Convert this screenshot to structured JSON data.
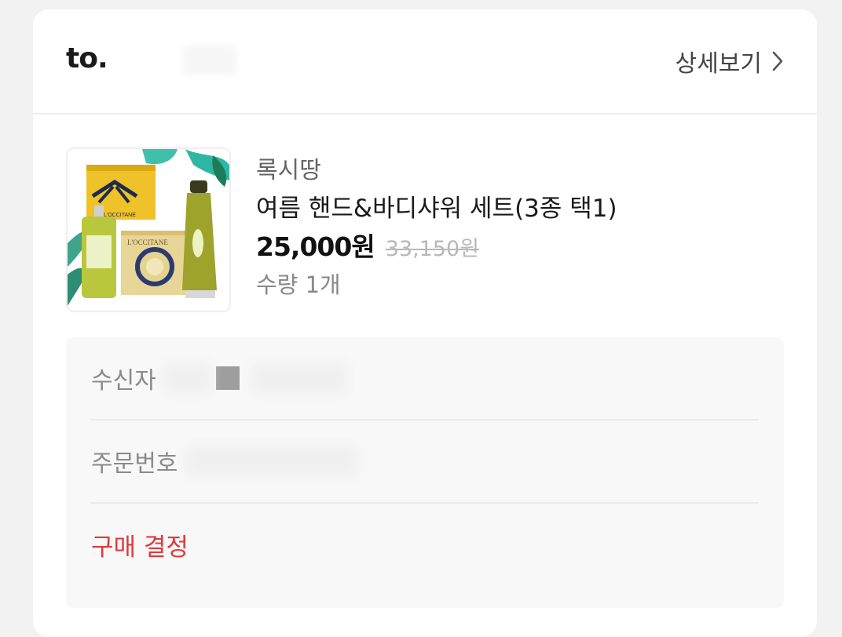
{
  "header": {
    "to_label": "to.",
    "detail_label": "상세보기"
  },
  "product": {
    "brand": "록시땅",
    "name": "여름 핸드&바디샤워 세트(3종 택1)",
    "price": "25,000원",
    "original_price": "33,150원",
    "quantity": "수량 1개",
    "image_brand_text": "L'OCCITANE"
  },
  "info": {
    "recipient_label": "수신자",
    "order_number_label": "주문번호",
    "status": "구매 결정"
  },
  "colors": {
    "status": "#e03a3a",
    "card_bg": "#ffffff",
    "page_bg": "#f2f2f2"
  },
  "icons": {
    "detail_chevron": "chevron-right-icon"
  }
}
